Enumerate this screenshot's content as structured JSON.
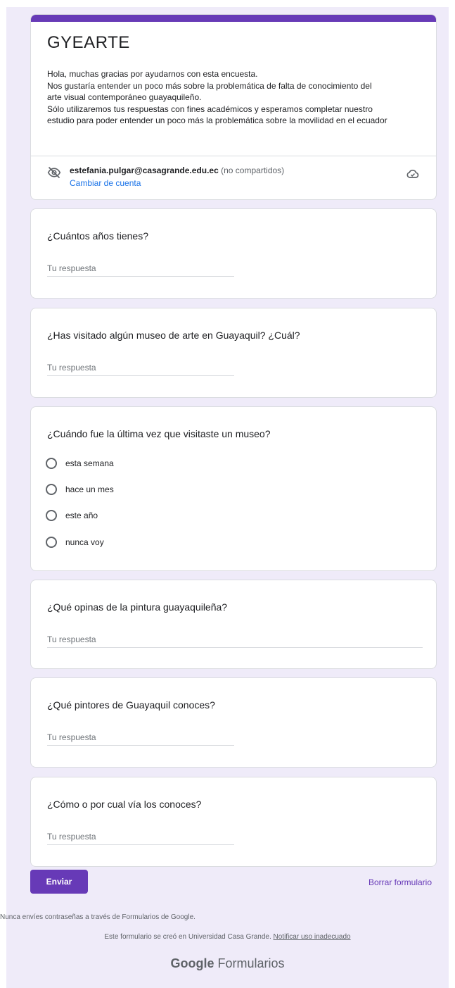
{
  "header": {
    "title": "GYEARTE",
    "description": [
      "Hola, muchas gracias por ayudarnos con esta encuesta.",
      "Nos gustaría entender un poco más sobre la problemática de falta de conocimiento del",
      "arte visual contemporáneo guayaquileño.",
      "Sólo utilizaremos tus respuestas con fines académicos y esperamos completar nuestro",
      "estudio para poder entender un poco más la problemática sobre la movilidad en el ecuador"
    ],
    "account_email": "estefania.pulgar@casagrande.edu.ec",
    "account_note": "(no compartidos)",
    "switch_account": "Cambiar de cuenta"
  },
  "questions": [
    {
      "title": "¿Cuántos años tienes?",
      "placeholder": "Tu respuesta"
    },
    {
      "title": "¿Has visitado algún museo de arte en Guayaquil? ¿Cuál?",
      "placeholder": "Tu respuesta"
    },
    {
      "title": "¿Cuándo fue la última vez que visitaste un museo?",
      "options": [
        "esta semana",
        "hace un mes",
        "este año",
        "nunca voy"
      ]
    },
    {
      "title": "¿Qué opinas de la pintura guayaquileña?",
      "placeholder": "Tu respuesta"
    },
    {
      "title": "¿Qué pintores de Guayaquil conoces?",
      "placeholder": "Tu respuesta"
    },
    {
      "title": "¿Cómo o por cual vía los conoces?",
      "placeholder": "Tu respuesta"
    }
  ],
  "actions": {
    "submit_label": "Enviar",
    "clear_label": "Borrar formulario"
  },
  "footer": {
    "warning": "Nunca envíes contraseñas a través de Formularios de Google.",
    "created_text": "Este formulario se creó en Universidad Casa Grande.",
    "report_link": "Notificar uso inadecuado",
    "brand_google": "Google",
    "brand_forms": "Formularios"
  },
  "colors": {
    "accent": "#673ab7",
    "background": "#efebf9",
    "link": "#1a73e8"
  }
}
